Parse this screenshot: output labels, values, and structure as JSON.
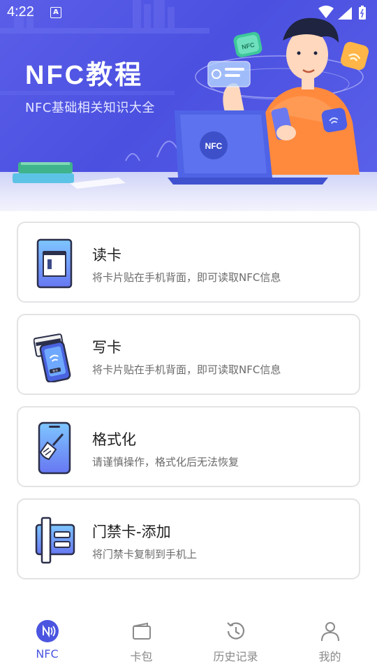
{
  "status_bar": {
    "time": "4:22",
    "notification_icon": "A"
  },
  "banner": {
    "title": "NFC教程",
    "subtitle": "NFC基础相关知识大全",
    "badges": {
      "nfc_chip": "NFC",
      "laptop_logo": "NFC",
      "phone_badge": "NFC"
    }
  },
  "cards": [
    {
      "title": "读卡",
      "desc": "将卡片贴在手机背面，即可读取NFC信息",
      "icon": "card-reader-icon"
    },
    {
      "title": "写卡",
      "desc": "将卡片贴在手机背面，即可读取NFC信息",
      "icon": "phone-card-write-icon",
      "icon_badge": "写卡"
    },
    {
      "title": "格式化",
      "desc": "请谨慎操作，格式化后无法恢复",
      "icon": "phone-broom-icon"
    },
    {
      "title": "门禁卡-添加",
      "desc": "将门禁卡复制到手机上",
      "icon": "access-card-icon"
    }
  ],
  "bottom_nav": {
    "active_color": "#4b55e0",
    "inactive_color": "#8a8a8a",
    "items": [
      {
        "label": "NFC",
        "icon": "nfc-icon",
        "active": true
      },
      {
        "label": "卡包",
        "icon": "wallet-icon",
        "active": false
      },
      {
        "label": "历史记录",
        "icon": "history-icon",
        "active": false
      },
      {
        "label": "我的",
        "icon": "person-icon",
        "active": false
      }
    ]
  },
  "colors": {
    "banner_bg": "#5a5ee8",
    "accent": "#4b55e0",
    "card_border": "#e3e3e6"
  }
}
